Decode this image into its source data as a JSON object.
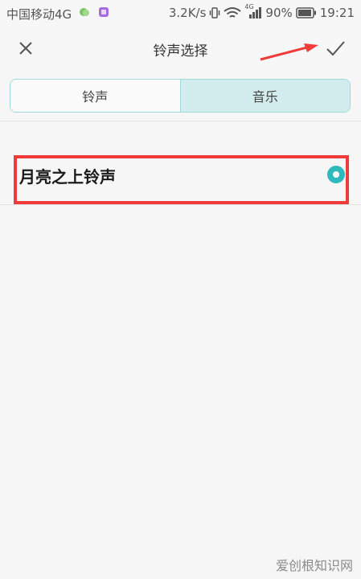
{
  "status_bar": {
    "carrier": "中国移动4G",
    "speed": "3.2K/s",
    "network_type": "4G",
    "battery": "90%",
    "time": "19:21"
  },
  "title_bar": {
    "title": "铃声选择"
  },
  "tabs": [
    {
      "label": "铃声",
      "selected": false
    },
    {
      "label": "音乐",
      "selected": true
    }
  ],
  "list": {
    "items": [
      {
        "label": "月亮之上铃声",
        "selected": true
      }
    ]
  },
  "watermark": "爱创根知识网",
  "colors": {
    "accent": "#2fb9bd",
    "annotation_red": "#f03b3b",
    "tab_selected_bg": "#d3ecee"
  }
}
